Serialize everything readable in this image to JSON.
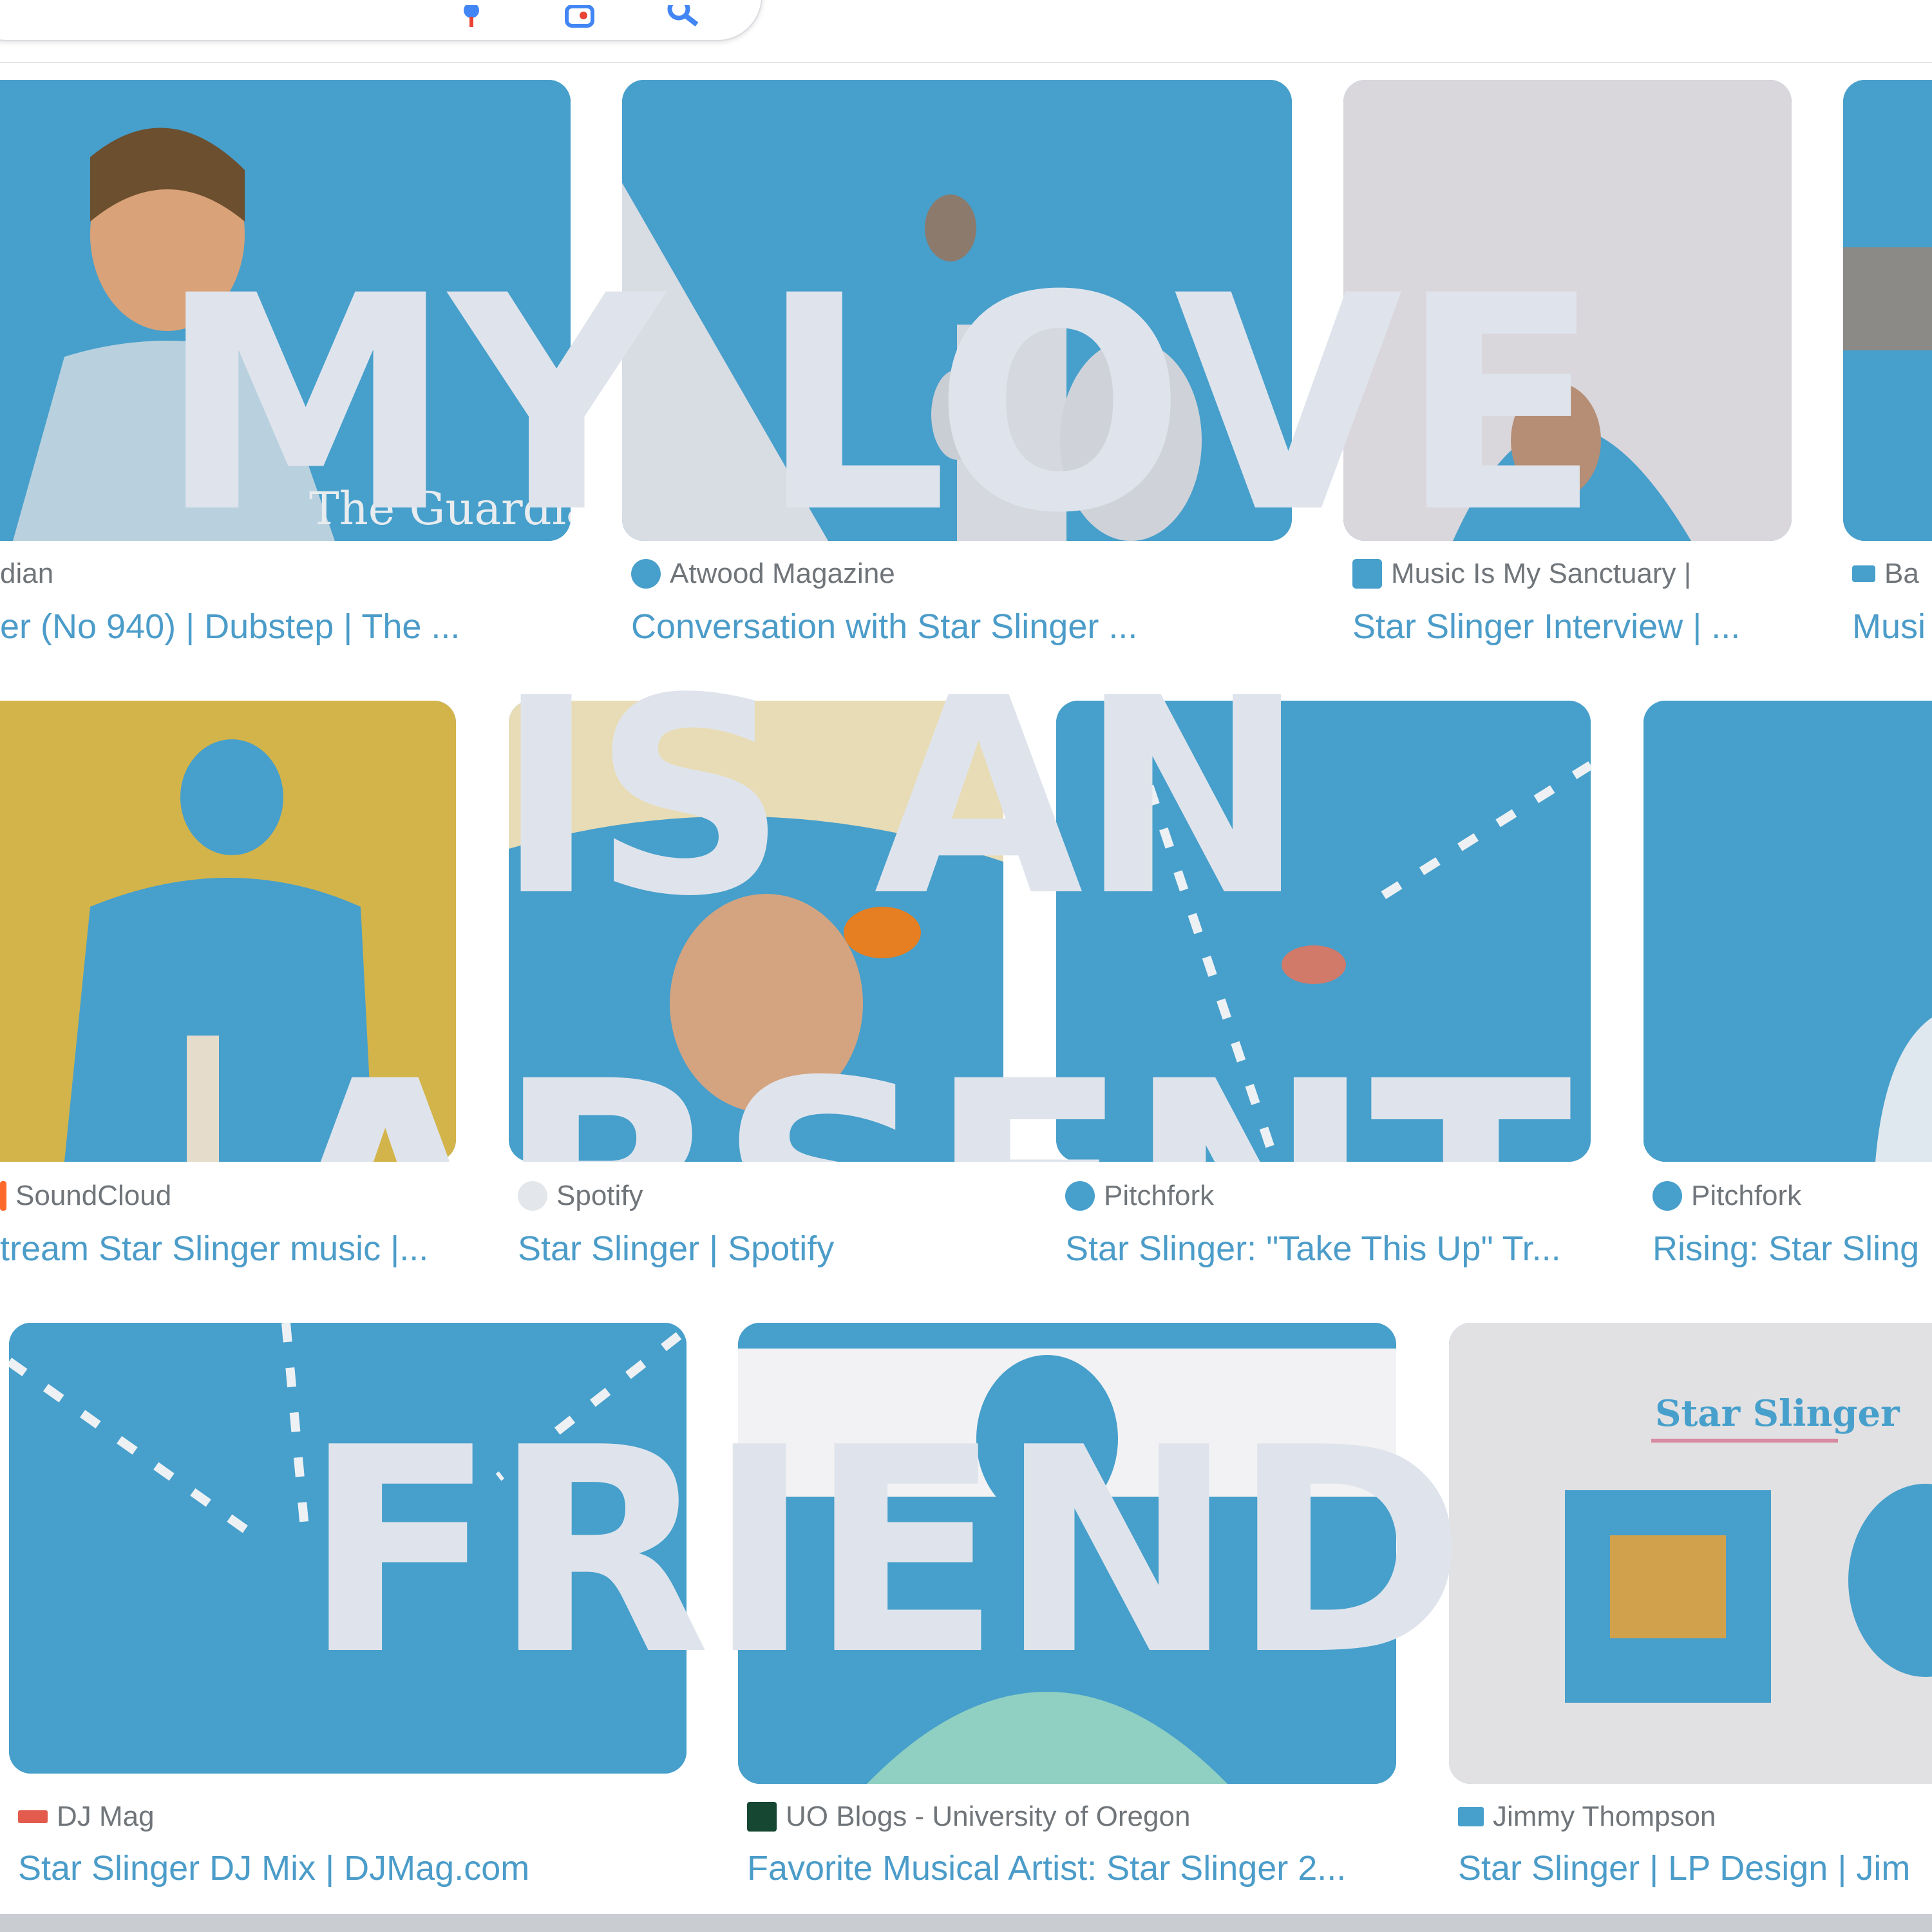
{
  "colors": {
    "accent": "#479fcb",
    "overlay_text": "#dfe4ec",
    "muted": "#70757a"
  },
  "search_icons": [
    "microphone-icon",
    "camera-lens-icon",
    "search-icon"
  ],
  "overlay": {
    "line1": "MY LOVE",
    "line2": "IS AN",
    "line3": "ABSENT",
    "line4": "FRIEND"
  },
  "results": [
    {
      "source": "dian",
      "title": "er (No 940) | Dubstep | The ...",
      "thumb_text": "The Guardian"
    },
    {
      "source": "Atwood Magazine",
      "title": "Conversation with Star Slinger ..."
    },
    {
      "source": "Music Is My Sanctuary |",
      "title": "Star Slinger Interview | ..."
    },
    {
      "source": "Ba",
      "title": "Musi"
    },
    {
      "source": "SoundCloud",
      "title": "tream Star Slinger music |..."
    },
    {
      "source": "Spotify",
      "title": "Star Slinger | Spotify"
    },
    {
      "source": "Pitchfork",
      "title": "Star Slinger: \"Take This Up\" Tr..."
    },
    {
      "source": "Pitchfork",
      "title": "Rising: Star Sling"
    },
    {
      "source": "DJ Mag",
      "title": "Star Slinger DJ Mix | DJMag.com"
    },
    {
      "source": "UO Blogs - University of Oregon",
      "title": "Favorite Musical Artist: Star Slinger 2..."
    },
    {
      "source": "Jimmy Thompson",
      "title": "Star Slinger | LP Design | Jim",
      "thumb_text": "Star Slinger"
    }
  ]
}
